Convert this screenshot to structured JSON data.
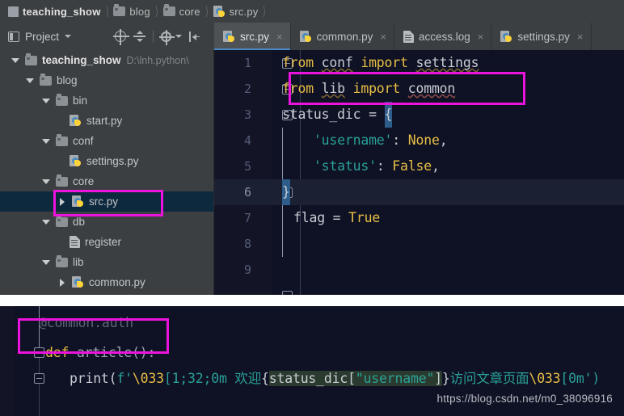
{
  "breadcrumb": {
    "items": [
      {
        "label": "teaching_show",
        "icon": "module-icon",
        "bold": true
      },
      {
        "label": "blog",
        "icon": "folder-icon",
        "bold": false
      },
      {
        "label": "core",
        "icon": "folder-icon",
        "bold": false
      },
      {
        "label": "src.py",
        "icon": "python-file-icon",
        "bold": false
      }
    ]
  },
  "toolbar": {
    "project_label": "Project",
    "icons": [
      "locate-target-icon",
      "collapse-all-icon",
      "settings-gear-icon",
      "hide-panel-icon"
    ]
  },
  "tabs": [
    {
      "label": "src.py",
      "icon": "python-file-icon",
      "active": true,
      "close": "×"
    },
    {
      "label": "common.py",
      "icon": "python-file-icon",
      "active": false,
      "close": "×"
    },
    {
      "label": "access.log",
      "icon": "text-file-icon",
      "active": false,
      "close": "×"
    },
    {
      "label": "settings.py",
      "icon": "python-file-icon",
      "active": false,
      "close": "×"
    }
  ],
  "tree": {
    "root_path": "D:\\lnh.python\\",
    "items": [
      {
        "label": "teaching_show",
        "indent": 0,
        "arrow": "down",
        "icon": "folder-icon",
        "bold": true,
        "selected": false
      },
      {
        "label": "blog",
        "indent": 1,
        "arrow": "down",
        "icon": "folder-icon",
        "bold": false,
        "selected": false
      },
      {
        "label": "bin",
        "indent": 2,
        "arrow": "down",
        "icon": "folder-icon",
        "bold": false,
        "selected": false
      },
      {
        "label": "start.py",
        "indent": 3,
        "arrow": "none",
        "icon": "python-file-icon",
        "bold": false,
        "selected": false
      },
      {
        "label": "conf",
        "indent": 2,
        "arrow": "down",
        "icon": "folder-icon",
        "bold": false,
        "selected": false
      },
      {
        "label": "settings.py",
        "indent": 3,
        "arrow": "none",
        "icon": "python-file-icon",
        "bold": false,
        "selected": false
      },
      {
        "label": "core",
        "indent": 2,
        "arrow": "down",
        "icon": "folder-icon",
        "bold": false,
        "selected": false
      },
      {
        "label": "src.py",
        "indent": 3,
        "arrow": "right",
        "icon": "python-file-icon",
        "bold": false,
        "selected": true
      },
      {
        "label": "db",
        "indent": 2,
        "arrow": "down",
        "icon": "folder-icon",
        "bold": false,
        "selected": false
      },
      {
        "label": "register",
        "indent": 3,
        "arrow": "none",
        "icon": "text-file-icon",
        "bold": false,
        "selected": false
      },
      {
        "label": "lib",
        "indent": 2,
        "arrow": "down",
        "icon": "folder-icon",
        "bold": false,
        "selected": false
      },
      {
        "label": "common.py",
        "indent": 3,
        "arrow": "right",
        "icon": "python-file-icon",
        "bold": false,
        "selected": false
      }
    ]
  },
  "editor": {
    "filename": "src.py",
    "current_line": 6,
    "lines": [
      {
        "number": "1",
        "text": "from conf import settings"
      },
      {
        "number": "2",
        "text": "from lib import common"
      },
      {
        "number": "3",
        "text": "status_dic = {"
      },
      {
        "number": "4",
        "text": "    'username': None,"
      },
      {
        "number": "5",
        "text": "    'status': False,"
      },
      {
        "number": "6",
        "text": "}"
      },
      {
        "number": "7",
        "text": "flag = True"
      },
      {
        "number": "8",
        "text": ""
      },
      {
        "number": "9",
        "text": ""
      }
    ]
  },
  "bottom_editor": {
    "lines": [
      {
        "text": "@common.auth"
      },
      {
        "text": "def article():"
      },
      {
        "text": "    print(f'\\033[1;32;0m 欢迎{status_dic[\"username\"]}访问文章页面\\033[0m')"
      }
    ],
    "decorator": "@common.auth",
    "def_keyword": "def",
    "def_name": "article():",
    "print_keyword": "print",
    "fstring_prefix": "f'",
    "escape1": "\\033",
    "ansi1": "[1;32;0m",
    "text1": " 欢迎",
    "brace_open": "{",
    "dict_name": "status_dic",
    "bracket_open": "[",
    "dict_key": "\"username\"",
    "bracket_close": "]",
    "brace_close": "}",
    "text2": "访问文章页面",
    "escape2": "\\033",
    "ansi2": "[0m",
    "tail": "')"
  },
  "annotations": {
    "color": "#ec13dc",
    "boxes": [
      "tree-src-py-highlight",
      "import-line-highlight",
      "decorator-highlight"
    ]
  },
  "watermark": "https://blog.csdn.net/m0_38096916",
  "colors": {
    "ide_chrome": "#3c3f41",
    "editor_bg": "#0f1124",
    "selection_row": "#0d293e",
    "accent_tab_underline": "#4a88c7",
    "annotation_magenta": "#ec13dc",
    "keyword": "#e8bf45",
    "string": "#2aa198",
    "plain": "#c8cdd4"
  }
}
